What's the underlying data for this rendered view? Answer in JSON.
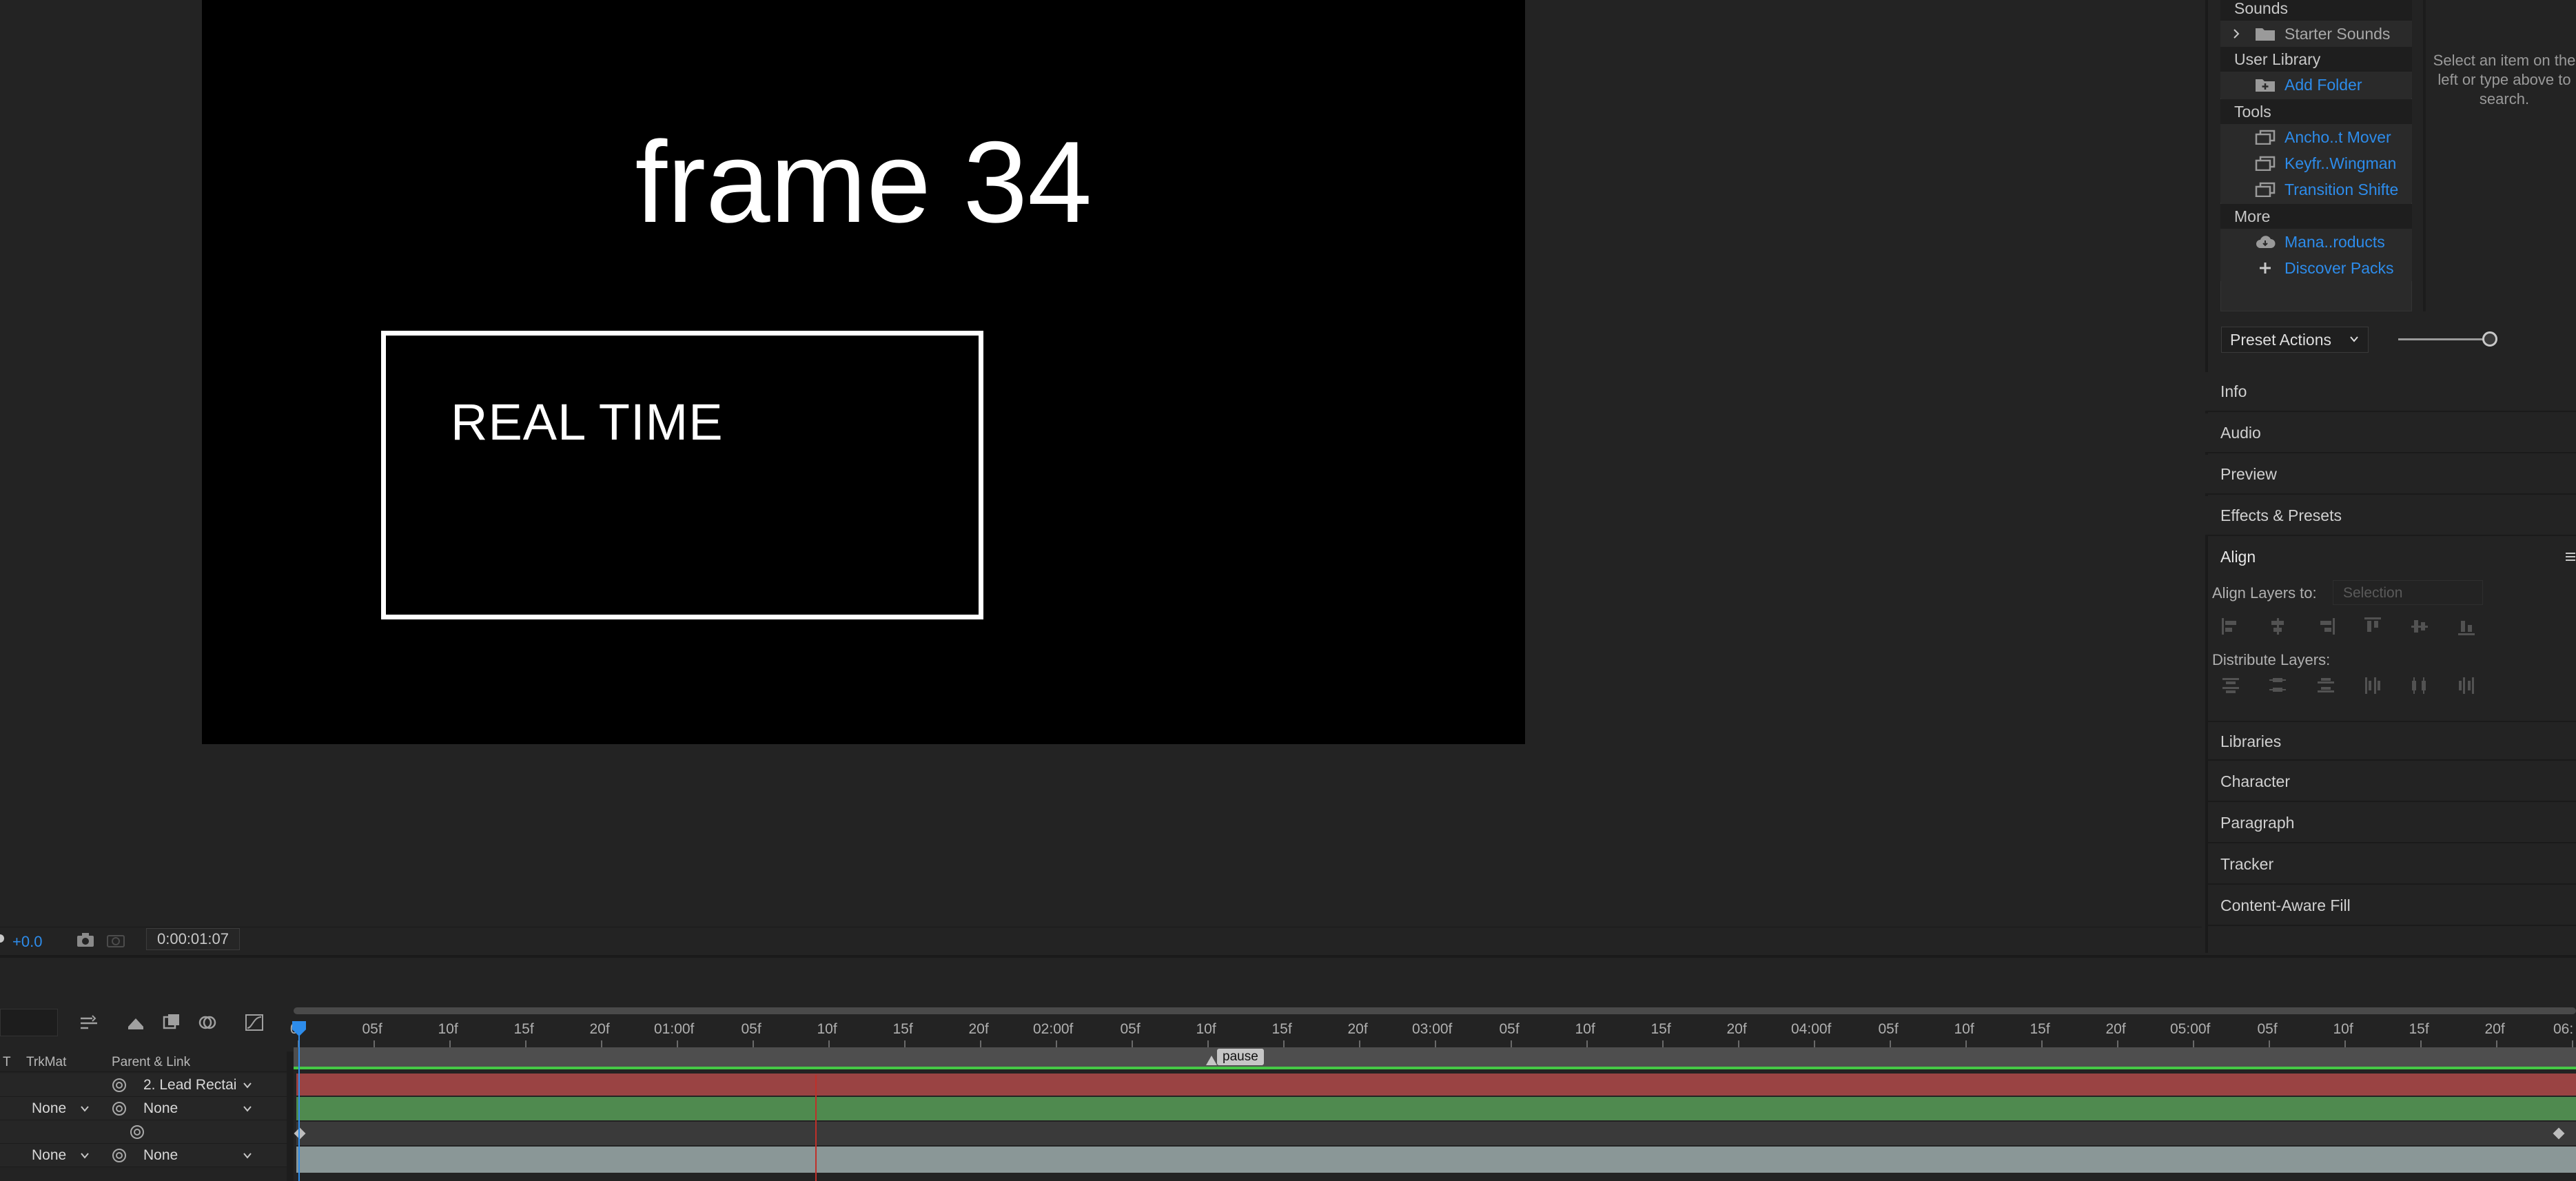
{
  "viewer": {
    "frame_title": "frame 34",
    "box_text": "REAL TIME",
    "exposure": "+0.0",
    "timecode": "0:00:01:07"
  },
  "library": {
    "sections": {
      "sounds": "Sounds",
      "user_library": "User Library",
      "tools": "Tools",
      "more": "More"
    },
    "items": {
      "starter_sounds": "Starter Sounds",
      "add_folder": "Add Folder",
      "anchor_mover": "Ancho..t Mover",
      "keyframe_wingman": "Keyfr..Wingman",
      "transition_shifter": "Transition Shifte",
      "manage_products": "Mana..roducts",
      "discover_packs": "Discover Packs"
    },
    "search_hint": "Select an item on the left or type above to search."
  },
  "preset_actions": {
    "label": "Preset Actions"
  },
  "panels": {
    "info": "Info",
    "audio": "Audio",
    "preview": "Preview",
    "effects_presets": "Effects & Presets",
    "align": "Align",
    "libraries": "Libraries",
    "character": "Character",
    "paragraph": "Paragraph",
    "tracker": "Tracker",
    "content_aware_fill": "Content-Aware Fill"
  },
  "align": {
    "align_layers_to_label": "Align Layers to:",
    "align_layers_to_value": "Selection",
    "distribute_label": "Distribute Layers:"
  },
  "timeline": {
    "columns": {
      "t": "T",
      "trkmat": "TrkMat",
      "parent_link": "Parent & Link"
    },
    "ruler_labels": [
      "0f",
      "05f",
      "10f",
      "15f",
      "20f",
      "01:00f",
      "05f",
      "10f",
      "15f",
      "20f",
      "02:00f",
      "05f",
      "10f",
      "15f",
      "20f",
      "03:00f",
      "05f",
      "10f",
      "15f",
      "20f",
      "04:00f",
      "05f",
      "10f",
      "15f",
      "20f",
      "05:00f",
      "05f",
      "10f",
      "15f",
      "20f",
      "06:"
    ],
    "marker_label": "pause",
    "rows": [
      {
        "trkmat": "",
        "parent": "2. Lead Rectai"
      },
      {
        "trkmat": "None",
        "parent": "None"
      },
      {
        "trkmat": "",
        "parent": ""
      },
      {
        "trkmat": "None",
        "parent": "None"
      }
    ]
  }
}
